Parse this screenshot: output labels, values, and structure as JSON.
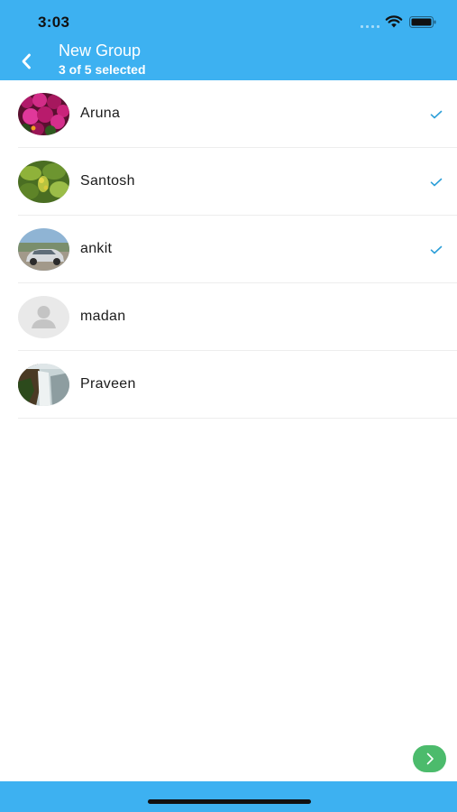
{
  "status_bar": {
    "time": "3:03"
  },
  "header": {
    "title": "New Group",
    "subtitle": "3 of 5 selected",
    "back_icon": "chevron-left-icon",
    "background": "#3db1f1"
  },
  "contacts": [
    {
      "name": "Aruna",
      "selected": true,
      "avatar": "flowers-photo"
    },
    {
      "name": "Santosh",
      "selected": true,
      "avatar": "leaves-photo"
    },
    {
      "name": "ankit",
      "selected": true,
      "avatar": "car-photo"
    },
    {
      "name": "madan",
      "selected": false,
      "avatar": "default-person-icon"
    },
    {
      "name": "Praveen",
      "selected": false,
      "avatar": "waterfall-photo"
    }
  ],
  "colors": {
    "accent": "#3db1f1",
    "check": "#2d9fd8",
    "next_button": "#4cbb6c"
  },
  "next_button": {
    "icon": "chevron-right-icon"
  }
}
